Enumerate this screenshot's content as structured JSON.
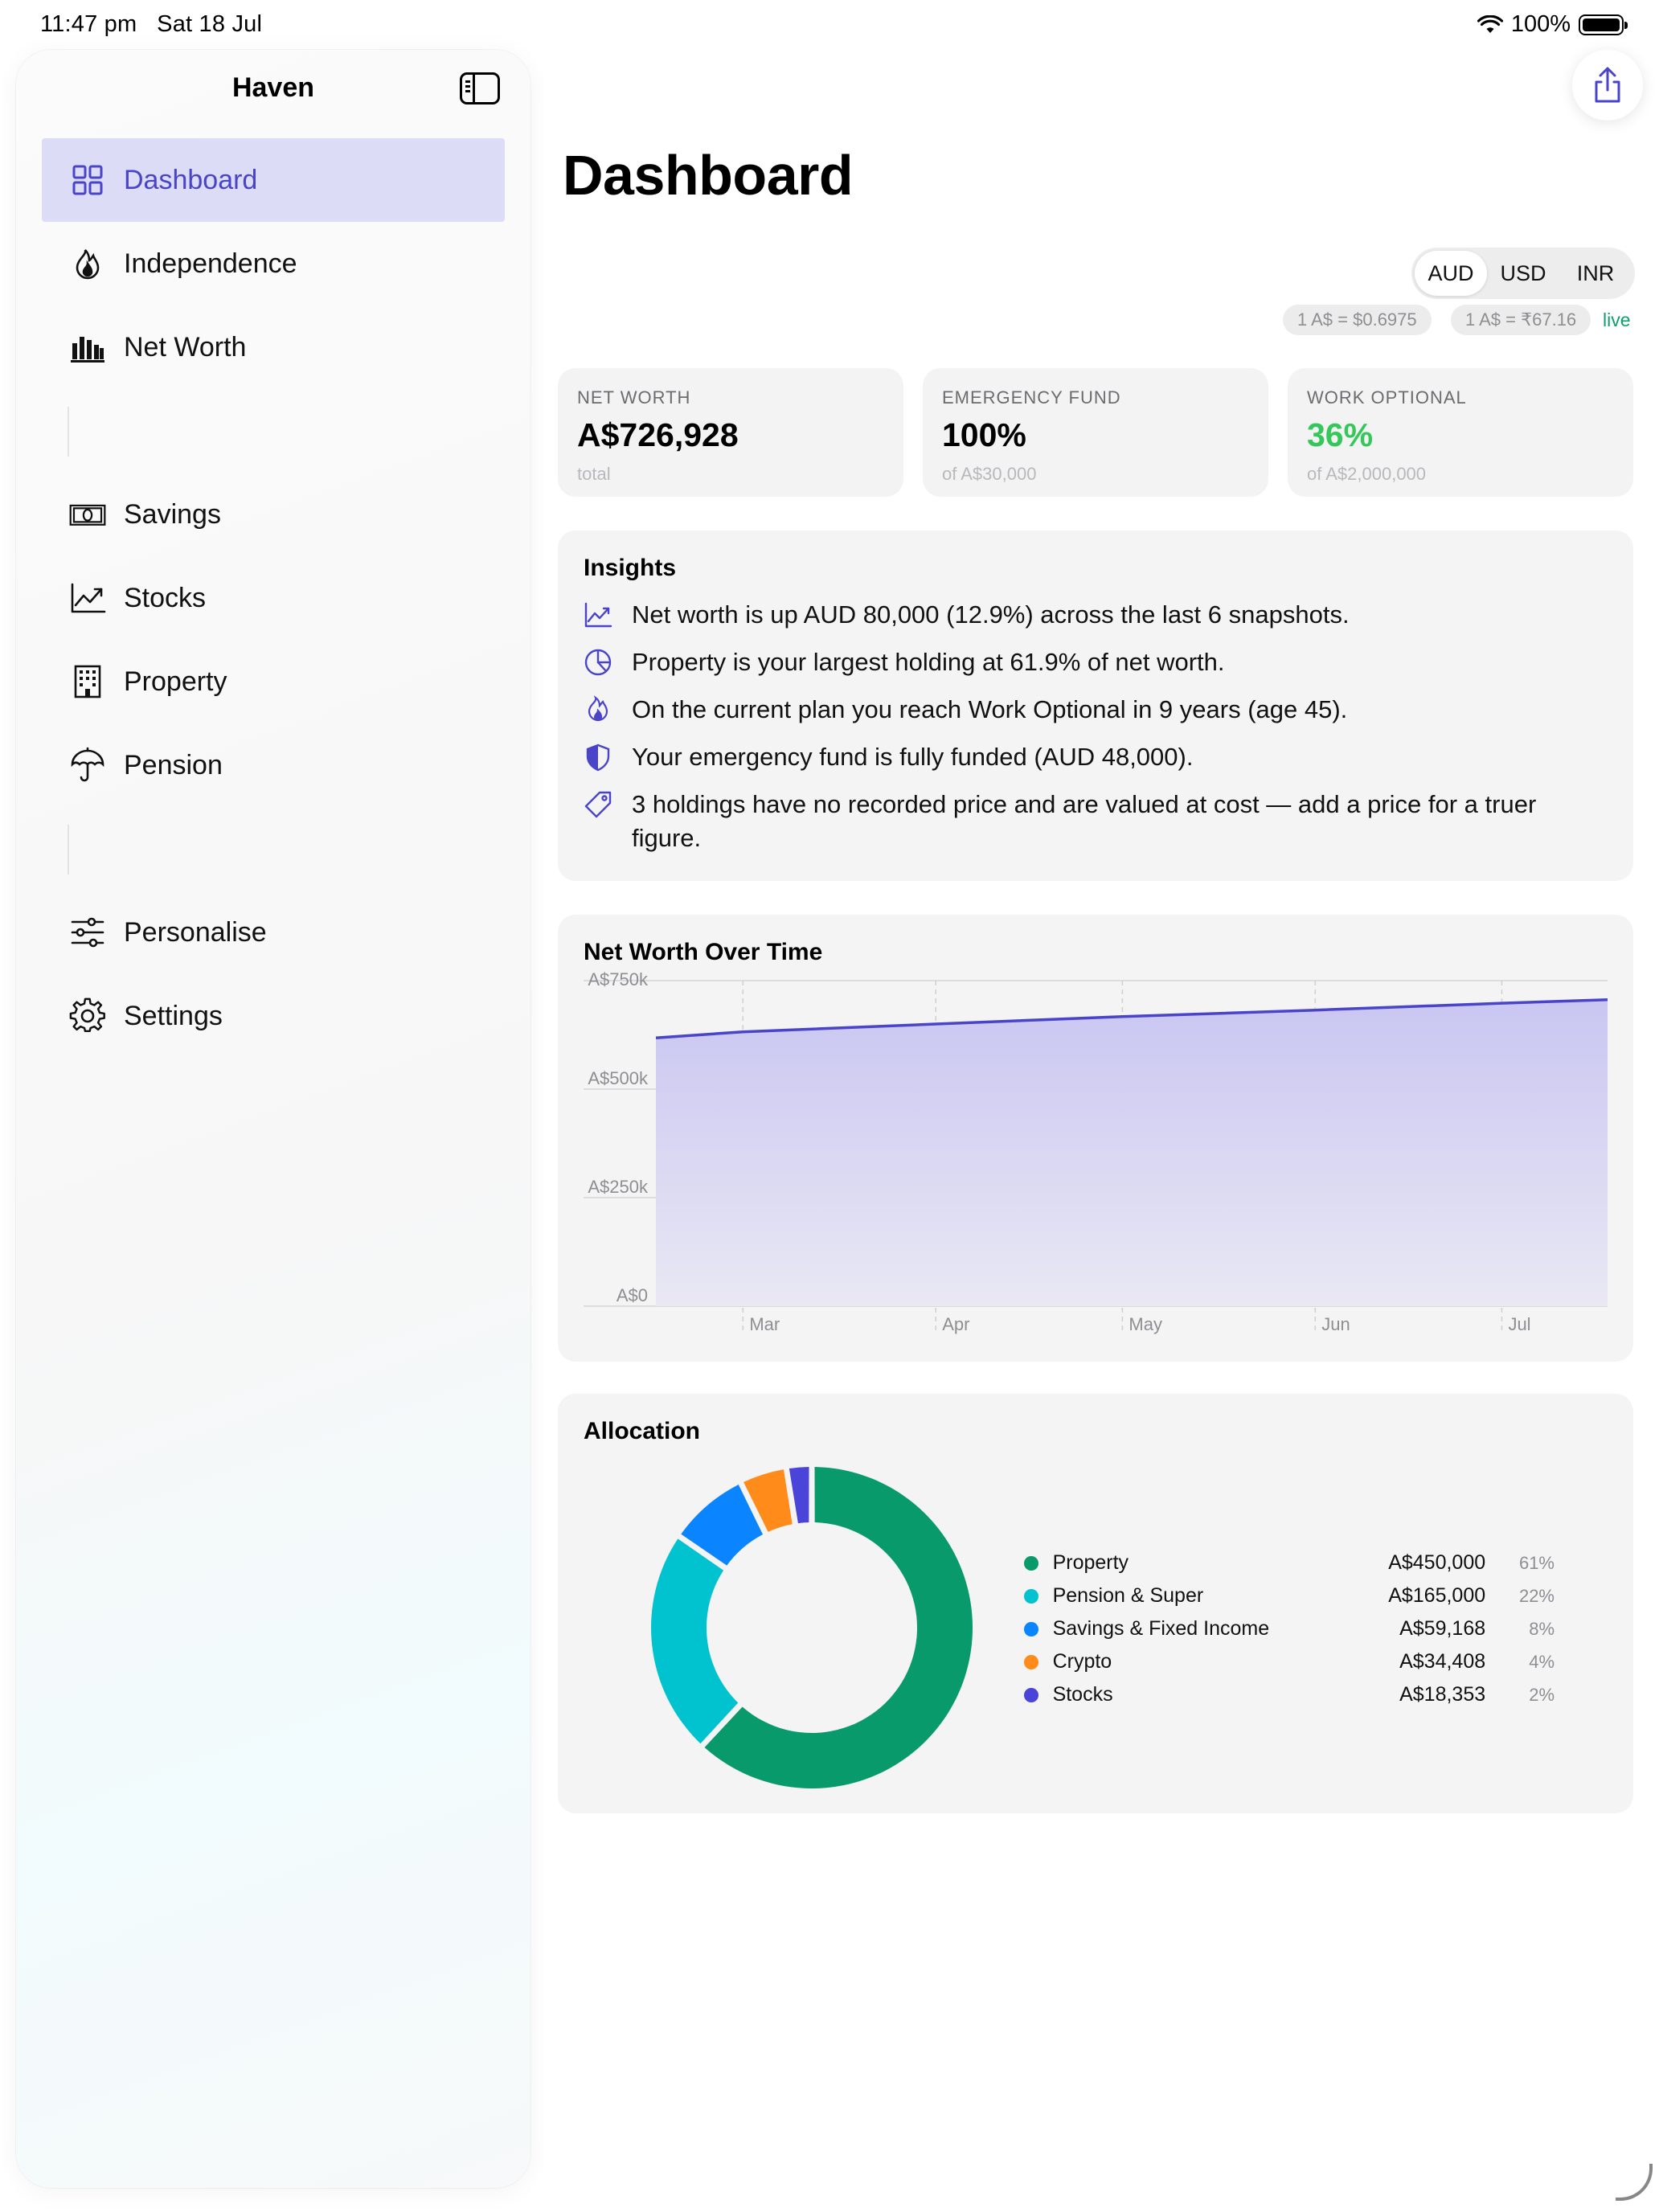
{
  "status": {
    "time": "11:47 pm",
    "date": "Sat 18 Jul",
    "battery": "100%"
  },
  "sidebar": {
    "title": "Haven",
    "items": [
      {
        "label": "Dashboard",
        "icon": "grid-icon",
        "active": true
      },
      {
        "label": "Independence",
        "icon": "flame-icon"
      },
      {
        "label": "Net Worth",
        "icon": "bar-chart-icon"
      },
      {
        "label": "Savings",
        "icon": "banknote-icon"
      },
      {
        "label": "Stocks",
        "icon": "trend-chart-icon"
      },
      {
        "label": "Property",
        "icon": "building-icon"
      },
      {
        "label": "Pension",
        "icon": "umbrella-icon"
      },
      {
        "label": "Personalise",
        "icon": "sliders-icon"
      },
      {
        "label": "Settings",
        "icon": "gear-icon"
      }
    ]
  },
  "main": {
    "title": "Dashboard",
    "currency": {
      "options": [
        "AUD",
        "USD",
        "INR"
      ],
      "selected": "AUD"
    },
    "rates": {
      "usd": "1 A$ = $0.6975",
      "inr": "1 A$ = ₹67.16",
      "live": "live"
    },
    "stats": [
      {
        "label": "NET WORTH",
        "value": "A$726,928",
        "sub": "total"
      },
      {
        "label": "EMERGENCY FUND",
        "value": "100%",
        "sub": "of A$30,000"
      },
      {
        "label": "WORK OPTIONAL",
        "value": "36%",
        "sub": "of A$2,000,000",
        "value_color": "#34c759"
      }
    ],
    "insights": {
      "title": "Insights",
      "items": [
        {
          "icon": "trend-up-icon",
          "text": "Net worth is up AUD 80,000 (12.9%) across the last 6 snapshots."
        },
        {
          "icon": "pie-icon",
          "text": "Property is your largest holding at 61.9% of net worth."
        },
        {
          "icon": "flame-icon",
          "text": "On the current plan you reach Work Optional in 9 years (age 45)."
        },
        {
          "icon": "shield-icon",
          "text": "Your emergency fund is fully funded (AUD 48,000)."
        },
        {
          "icon": "tag-icon",
          "text": "3 holdings have no recorded price and are valued at cost — add a price for a truer figure."
        }
      ]
    },
    "net_worth_chart": {
      "title": "Net Worth Over Time"
    },
    "allocation": {
      "title": "Allocation"
    }
  },
  "chart_data": [
    {
      "type": "area",
      "title": "Net Worth Over Time",
      "x": [
        "2026-02-15",
        "2026-03-01",
        "2026-04-01",
        "2026-05-01",
        "2026-06-01",
        "2026-07-01",
        "2026-07-18"
      ],
      "x_tick_labels": [
        "Mar",
        "Apr",
        "May",
        "Jun",
        "Jul"
      ],
      "values": [
        618000,
        632000,
        650000,
        667000,
        682000,
        698000,
        706000
      ],
      "y_tick_labels": [
        "A$0",
        "A$250k",
        "A$500k",
        "A$750k"
      ],
      "ylim": [
        0,
        750000
      ],
      "grid": true,
      "color": "#4a44c9"
    },
    {
      "type": "pie",
      "title": "Allocation",
      "categories": [
        "Property",
        "Pension & Super",
        "Savings & Fixed Income",
        "Crypto",
        "Stocks"
      ],
      "values": [
        450000,
        165000,
        59168,
        34408,
        18353
      ],
      "amount_labels": [
        "A$450,000",
        "A$165,000",
        "A$59,168",
        "A$34,408",
        "A$18,353"
      ],
      "percent_labels": [
        "61%",
        "22%",
        "8%",
        "4%",
        "2%"
      ],
      "colors": [
        "#089a6b",
        "#00c3cf",
        "#0a84ff",
        "#ff8c1a",
        "#4a44d8"
      ],
      "donut": true
    }
  ]
}
